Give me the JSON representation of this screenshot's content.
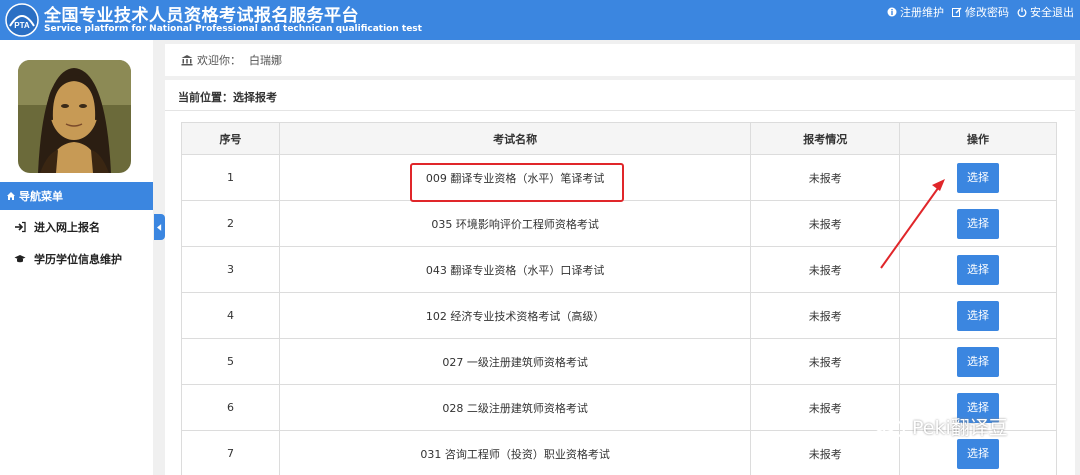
{
  "header": {
    "title": "全国专业技术人员资格考试报名服务平台",
    "subtitle": "Service platform for National Professional and technican qualification test",
    "logo_text": "PTA",
    "links": [
      {
        "icon": "info-circle-icon",
        "label": "注册维护"
      },
      {
        "icon": "edit-icon",
        "label": "修改密码"
      },
      {
        "icon": "power-icon",
        "label": "安全退出"
      }
    ]
  },
  "sidebar": {
    "nav_header": "导航菜单",
    "items": [
      {
        "icon": "sign-in-icon",
        "label": "进入网上报名"
      },
      {
        "icon": "graduation-cap-icon",
        "label": "学历学位信息维护"
      }
    ]
  },
  "welcome": {
    "prefix": "欢迎你：",
    "user": "白瑞娜"
  },
  "location": "当前位置：选择报考",
  "table": {
    "headers": [
      "序号",
      "考试名称",
      "报考情况",
      "操作"
    ],
    "rows": [
      {
        "no": "1",
        "name": "009 翻译专业资格（水平）笔译考试",
        "status": "未报考",
        "action": "选择"
      },
      {
        "no": "2",
        "name": "035 环境影响评价工程师资格考试",
        "status": "未报考",
        "action": "选择"
      },
      {
        "no": "3",
        "name": "043 翻译专业资格（水平）口译考试",
        "status": "未报考",
        "action": "选择"
      },
      {
        "no": "4",
        "name": "102 经济专业技术资格考试（高级）",
        "status": "未报考",
        "action": "选择"
      },
      {
        "no": "5",
        "name": "027 一级注册建筑师资格考试",
        "status": "未报考",
        "action": "选择"
      },
      {
        "no": "6",
        "name": "028 二级注册建筑师资格考试",
        "status": "未报考",
        "action": "选择"
      },
      {
        "no": "7",
        "name": "031 咨询工程师（投资）职业资格考试",
        "status": "未报考",
        "action": "选择"
      }
    ]
  },
  "watermark": "Peki翻译豆",
  "colors": {
    "accent": "#3b86e0",
    "highlight": "#e0262a"
  }
}
